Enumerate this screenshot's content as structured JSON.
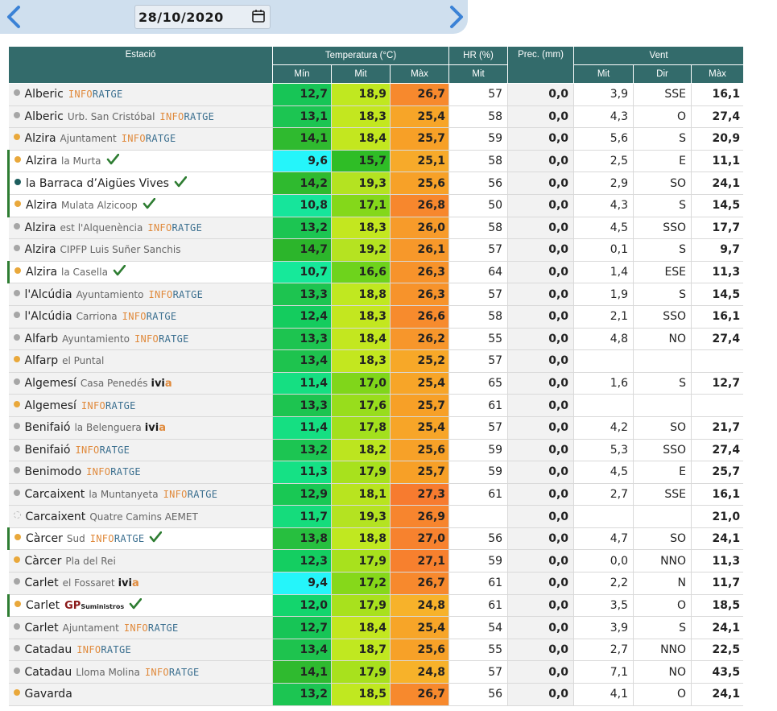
{
  "date": "28/10/2020",
  "header": {
    "station": "Estació",
    "temperature": "Temperatura (°C)",
    "humidity": "HR (%)",
    "precip": "Prec. (mm)",
    "wind": "Vent",
    "t_min": "Mín",
    "t_avg": "Mit",
    "t_max": "Màx",
    "hr_avg": "Mit",
    "w_avg": "Mit",
    "w_dir": "Dir",
    "w_max": "Màx"
  },
  "colors": {
    "header_bg": "#336b6b",
    "dot_grey": "#a6a6a6",
    "dot_orange": "#e9a83b",
    "dot_teal": "#1d5e5e",
    "check": "#2e7d32"
  },
  "rows": [
    {
      "name": "Alberic",
      "sub": "",
      "logo": "INFORATGE",
      "dot": "grey",
      "check": false,
      "sel": false,
      "tmin": "12,7",
      "tavg": "18,9",
      "tmax": "26,7",
      "hr": "57",
      "prec": "0,0",
      "wavg": "3,9",
      "wdir": "SSE",
      "wmax": "16,1",
      "cmin": "#17c556",
      "cavg": "#c0e820",
      "cmax": "#f7892d"
    },
    {
      "name": "Alberic",
      "sub": "Urb. San Cristóbal",
      "logo": "INFORATGE",
      "dot": "grey",
      "check": false,
      "sel": false,
      "tmin": "13,1",
      "tavg": "18,3",
      "tmax": "25,4",
      "hr": "58",
      "prec": "0,0",
      "wavg": "4,3",
      "wdir": "O",
      "wmax": "27,4",
      "cmin": "#1cc552",
      "cavg": "#c3e71f",
      "cmax": "#f7a528"
    },
    {
      "name": "Alzira",
      "sub": "Ajuntament",
      "logo": "INFORATGE",
      "dot": "orange",
      "check": false,
      "sel": false,
      "tmin": "14,1",
      "tavg": "18,4",
      "tmax": "25,7",
      "hr": "59",
      "prec": "0,0",
      "wavg": "5,6",
      "wdir": "S",
      "wmax": "20,9",
      "cmin": "#2fba2f",
      "cavg": "#c3e71f",
      "cmax": "#f7a027"
    },
    {
      "name": "Alzira",
      "sub": "la Murta",
      "logo": "",
      "dot": "orange",
      "check": true,
      "sel": true,
      "tmin": "9,6",
      "tavg": "15,7",
      "tmax": "25,1",
      "hr": "58",
      "prec": "0,0",
      "wavg": "2,5",
      "wdir": "E",
      "wmax": "11,1",
      "cmin": "#25f5fa",
      "cavg": "#2fbd26",
      "cmax": "#f7aa2a"
    },
    {
      "name": "la Barraca d’Aigües Vives",
      "sub": "",
      "logo": "",
      "dot": "teal",
      "check": true,
      "sel": true,
      "tmin": "14,2",
      "tavg": "19,3",
      "tmax": "25,6",
      "hr": "56",
      "prec": "0,0",
      "wavg": "2,9",
      "wdir": "SO",
      "wmax": "24,1",
      "cmin": "#2fba2f",
      "cavg": "#b4e321",
      "cmax": "#f7a128"
    },
    {
      "name": "Alzira",
      "sub": "Mulata Alzicoop",
      "logo": "",
      "dot": "orange",
      "check": true,
      "sel": true,
      "tmin": "10,8",
      "tavg": "17,1",
      "tmax": "26,8",
      "hr": "50",
      "prec": "0,0",
      "wavg": "4,3",
      "wdir": "S",
      "wmax": "14,5",
      "cmin": "#16e59b",
      "cavg": "#84d81a",
      "cmax": "#f7872d"
    },
    {
      "name": "Alzira",
      "sub": "est l'Alquenència",
      "logo": "INFORATGE",
      "dot": "grey",
      "check": false,
      "sel": false,
      "tmin": "13,2",
      "tavg": "18,3",
      "tmax": "26,0",
      "hr": "58",
      "prec": "0,0",
      "wavg": "4,5",
      "wdir": "SSO",
      "wmax": "17,7",
      "cmin": "#1cc552",
      "cavg": "#c3e71f",
      "cmax": "#f79b2a"
    },
    {
      "name": "Alzira",
      "sub": "CIPFP Luis Suñer Sanchis",
      "logo": "",
      "dot": "grey",
      "check": false,
      "sel": false,
      "tmin": "14,7",
      "tavg": "19,2",
      "tmax": "26,1",
      "hr": "57",
      "prec": "0,0",
      "wavg": "0,1",
      "wdir": "S",
      "wmax": "9,7",
      "cmin": "#2cb52b",
      "cavg": "#b5e321",
      "cmax": "#f7982a"
    },
    {
      "name": "Alzira",
      "sub": "la Casella",
      "logo": "",
      "dot": "orange",
      "check": true,
      "sel": true,
      "tmin": "10,7",
      "tavg": "16,6",
      "tmax": "26,3",
      "hr": "64",
      "prec": "0,0",
      "wavg": "1,4",
      "wdir": "ESE",
      "wmax": "11,3",
      "cmin": "#16e99a",
      "cavg": "#6ed31c",
      "cmax": "#f7932b"
    },
    {
      "name": "l'Alcúdia",
      "sub": "Ayuntamiento",
      "logo": "INFORATGE",
      "dot": "grey",
      "check": false,
      "sel": false,
      "tmin": "13,3",
      "tavg": "18,8",
      "tmax": "26,3",
      "hr": "57",
      "prec": "0,0",
      "wavg": "1,9",
      "wdir": "S",
      "wmax": "14,5",
      "cmin": "#1dc450",
      "cavg": "#c0e820",
      "cmax": "#f7932b"
    },
    {
      "name": "l'Alcúdia",
      "sub": "Carriona",
      "logo": "INFORATGE",
      "dot": "grey",
      "check": false,
      "sel": false,
      "tmin": "12,4",
      "tavg": "18,3",
      "tmax": "26,6",
      "hr": "58",
      "prec": "0,0",
      "wavg": "2,1",
      "wdir": "SSO",
      "wmax": "16,1",
      "cmin": "#14cc5e",
      "cavg": "#c3e71f",
      "cmax": "#f78b2d"
    },
    {
      "name": "Alfarb",
      "sub": "Ayuntamiento",
      "logo": "INFORATGE",
      "dot": "grey",
      "check": false,
      "sel": false,
      "tmin": "13,3",
      "tavg": "18,4",
      "tmax": "26,2",
      "hr": "55",
      "prec": "0,0",
      "wavg": "4,8",
      "wdir": "NO",
      "wmax": "27,4",
      "cmin": "#1dc450",
      "cavg": "#c3e71f",
      "cmax": "#f7962b"
    },
    {
      "name": "Alfarp",
      "sub": "el Puntal",
      "logo": "",
      "dot": "orange",
      "check": false,
      "sel": false,
      "tmin": "13,4",
      "tavg": "18,3",
      "tmax": "25,2",
      "hr": "57",
      "prec": "0,0",
      "wavg": "",
      "wdir": "",
      "wmax": "",
      "cmin": "#1ec34e",
      "cavg": "#c3e71f",
      "cmax": "#f7a828"
    },
    {
      "name": "Algemesí",
      "sub": "Casa Penedés",
      "logo": "IVIA",
      "dot": "grey",
      "check": false,
      "sel": false,
      "tmin": "11,4",
      "tavg": "17,0",
      "tmax": "25,4",
      "hr": "65",
      "prec": "0,0",
      "wavg": "1,6",
      "wdir": "S",
      "wmax": "12,7",
      "cmin": "#15df82",
      "cavg": "#80d61a",
      "cmax": "#f7a528"
    },
    {
      "name": "Algemesí",
      "sub": "",
      "logo": "INFORATGE",
      "dot": "orange",
      "check": false,
      "sel": false,
      "tmin": "13,3",
      "tavg": "17,6",
      "tmax": "25,7",
      "hr": "61",
      "prec": "0,0",
      "wavg": "",
      "wdir": "",
      "wmax": "",
      "cmin": "#1dc450",
      "cavg": "#98dd1c",
      "cmax": "#f7a027"
    },
    {
      "name": "Benifaió",
      "sub": "la Belenguera",
      "logo": "IVIA",
      "dot": "grey",
      "check": false,
      "sel": false,
      "tmin": "11,4",
      "tavg": "17,8",
      "tmax": "25,4",
      "hr": "57",
      "prec": "0,0",
      "wavg": "4,2",
      "wdir": "SO",
      "wmax": "21,7",
      "cmin": "#15df82",
      "cavg": "#a3e01d",
      "cmax": "#f7a528"
    },
    {
      "name": "Benifaió",
      "sub": "",
      "logo": "INFORATGE",
      "dot": "grey",
      "check": false,
      "sel": false,
      "tmin": "13,2",
      "tavg": "18,2",
      "tmax": "25,6",
      "hr": "59",
      "prec": "0,0",
      "wavg": "5,3",
      "wdir": "SSO",
      "wmax": "27,4",
      "cmin": "#1cc552",
      "cavg": "#bce51f",
      "cmax": "#f7a128"
    },
    {
      "name": "Benimodo",
      "sub": "",
      "logo": "INFORATGE",
      "dot": "grey",
      "check": false,
      "sel": false,
      "tmin": "11,3",
      "tavg": "17,9",
      "tmax": "25,7",
      "hr": "59",
      "prec": "0,0",
      "wavg": "4,5",
      "wdir": "E",
      "wmax": "25,7",
      "cmin": "#15e185",
      "cavg": "#a8e11d",
      "cmax": "#f7a027"
    },
    {
      "name": "Carcaixent",
      "sub": "la Muntanyeta",
      "logo": "INFORATGE",
      "dot": "grey",
      "check": false,
      "sel": false,
      "tmin": "12,9",
      "tavg": "18,1",
      "tmax": "27,3",
      "hr": "61",
      "prec": "0,0",
      "wavg": "2,7",
      "wdir": "SSE",
      "wmax": "16,1",
      "cmin": "#19c854",
      "cavg": "#b8e41f",
      "cmax": "#f77b2f"
    },
    {
      "name": "Carcaixent",
      "sub": "Quatre Camins AEMET",
      "logo": "",
      "dot": "empty",
      "check": false,
      "sel": false,
      "tmin": "11,7",
      "tavg": "19,3",
      "tmax": "26,9",
      "hr": "",
      "prec": "0,0",
      "wavg": "",
      "wdir": "",
      "wmax": "21,0",
      "cmin": "#15dc7c",
      "cavg": "#b4e321",
      "cmax": "#f7852e"
    },
    {
      "name": "Càrcer",
      "sub": "Sud",
      "logo": "INFORATGE",
      "dot": "orange",
      "check": true,
      "sel": true,
      "tmin": "13,8",
      "tavg": "18,8",
      "tmax": "27,0",
      "hr": "56",
      "prec": "0,0",
      "wavg": "4,7",
      "wdir": "SO",
      "wmax": "24,1",
      "cmin": "#27bf3f",
      "cavg": "#c0e820",
      "cmax": "#f7822e"
    },
    {
      "name": "Càrcer",
      "sub": "Pla del Rei",
      "logo": "",
      "dot": "orange",
      "check": false,
      "sel": false,
      "tmin": "12,3",
      "tavg": "17,9",
      "tmax": "27,1",
      "hr": "59",
      "prec": "0,0",
      "wavg": "0,0",
      "wdir": "NNO",
      "wmax": "11,3",
      "cmin": "#14ce61",
      "cavg": "#a8e11d",
      "cmax": "#f7802e"
    },
    {
      "name": "Carlet",
      "sub": "el Fossaret",
      "logo": "IVIA",
      "dot": "grey",
      "check": false,
      "sel": false,
      "tmin": "9,4",
      "tavg": "17,2",
      "tmax": "26,7",
      "hr": "61",
      "prec": "0,0",
      "wavg": "2,2",
      "wdir": "N",
      "wmax": "11,7",
      "cmin": "#25f5fa",
      "cavg": "#86d81a",
      "cmax": "#f7892d"
    },
    {
      "name": "Carlet",
      "sub": "",
      "logo": "GP",
      "dot": "orange",
      "check": true,
      "sel": true,
      "tmin": "12,0",
      "tavg": "17,9",
      "tmax": "24,8",
      "hr": "61",
      "prec": "0,0",
      "wavg": "3,5",
      "wdir": "O",
      "wmax": "18,5",
      "cmin": "#13d56d",
      "cavg": "#a8e11d",
      "cmax": "#f7b22a"
    },
    {
      "name": "Carlet",
      "sub": "Ajuntament",
      "logo": "INFORATGE",
      "dot": "grey",
      "check": false,
      "sel": false,
      "tmin": "12,7",
      "tavg": "18,4",
      "tmax": "25,4",
      "hr": "54",
      "prec": "0,0",
      "wavg": "3,9",
      "wdir": "S",
      "wmax": "24,1",
      "cmin": "#17c556",
      "cavg": "#c3e71f",
      "cmax": "#f7a528"
    },
    {
      "name": "Catadau",
      "sub": "",
      "logo": "INFORATGE",
      "dot": "grey",
      "check": false,
      "sel": false,
      "tmin": "13,4",
      "tavg": "18,7",
      "tmax": "25,6",
      "hr": "55",
      "prec": "0,0",
      "wavg": "2,7",
      "wdir": "NNO",
      "wmax": "22,5",
      "cmin": "#1ec34e",
      "cavg": "#c0e820",
      "cmax": "#f7a128"
    },
    {
      "name": "Catadau",
      "sub": "Lloma Molina",
      "logo": "INFORATGE",
      "dot": "grey",
      "check": false,
      "sel": false,
      "tmin": "14,1",
      "tavg": "17,9",
      "tmax": "24,8",
      "hr": "57",
      "prec": "0,0",
      "wavg": "7,1",
      "wdir": "NO",
      "wmax": "43,5",
      "cmin": "#2fba2f",
      "cavg": "#a8e11d",
      "cmax": "#f7b22a"
    },
    {
      "name": "Gavarda",
      "sub": "",
      "logo": "",
      "dot": "orange",
      "check": false,
      "sel": false,
      "tmin": "13,2",
      "tavg": "18,5",
      "tmax": "26,7",
      "hr": "56",
      "prec": "0,0",
      "wavg": "4,1",
      "wdir": "O",
      "wmax": "24,1",
      "cmin": "#1cc552",
      "cavg": "#c0e820",
      "cmax": "#f7892d"
    }
  ]
}
